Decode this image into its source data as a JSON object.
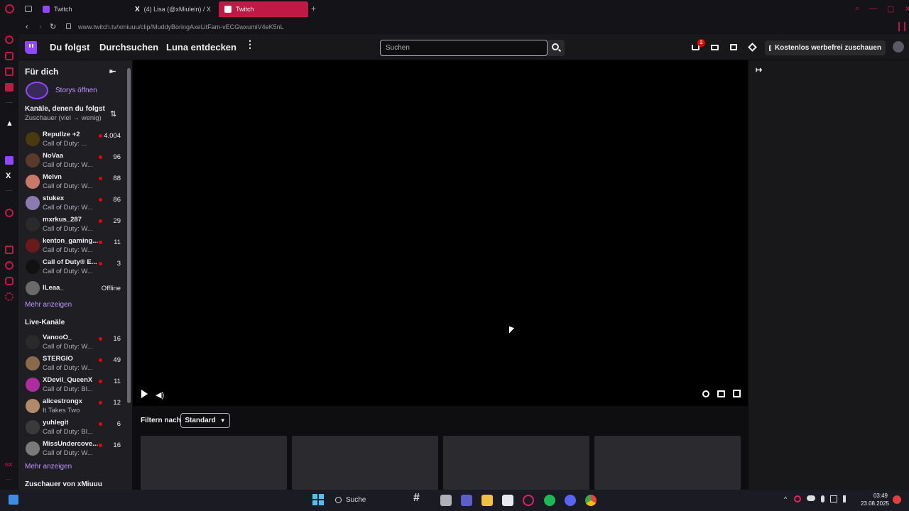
{
  "browser": {
    "tabs": [
      {
        "label": "Twitch",
        "active": false
      },
      {
        "label": "(4) Lisa (@xMiulein) / X",
        "active": false
      },
      {
        "label": "Twitch",
        "active": true
      }
    ],
    "url": "www.twitch.tv/xmiuuu/clip/MuddyBoringAxeLitFam-vECGwxumiV4eK5nL"
  },
  "nav": {
    "following": "Du folgst",
    "browse": "Durchsuchen",
    "luna": "Luna entdecken",
    "search_placeholder": "Suchen",
    "notif_count": "2",
    "adfree": "Kostenlos werbefrei zuschauen"
  },
  "sidebar": {
    "title": "Für dich",
    "stories": "Storys öffnen",
    "followed_title": "Kanäle, denen du folgst",
    "followed_sort": "Zuschauer (viel → wenig)",
    "followed": [
      {
        "name": "Repullze +2",
        "game": "Call of Duty: ...",
        "viewers": "4.004",
        "color": "#4a3a10"
      },
      {
        "name": "NoVaa",
        "game": "Call of Duty: W...",
        "viewers": "96",
        "color": "#5a3a2a"
      },
      {
        "name": "Melvn",
        "game": "Call of Duty: W...",
        "viewers": "88",
        "color": "#c87a6a"
      },
      {
        "name": "stukex",
        "game": "Call of Duty: W...",
        "viewers": "86",
        "color": "#8a7ab0"
      },
      {
        "name": "mxrkus_287",
        "game": "Call of Duty: W...",
        "viewers": "29",
        "color": "#2a2a2a"
      },
      {
        "name": "kenton_gaming...",
        "game": "Call of Duty: W...",
        "viewers": "11",
        "color": "#6a1a1a"
      },
      {
        "name": "Call of Duty® E...",
        "game": "Call of Duty: W...",
        "viewers": "3",
        "color": "#111111"
      },
      {
        "name": "lLeaa_",
        "game": "",
        "viewers": "Offline",
        "color": "#6a6a6a"
      }
    ],
    "more1": "Mehr anzeigen",
    "live_title": "Live-Kanäle",
    "live": [
      {
        "name": "VanooO_",
        "game": "Call of Duty: W...",
        "viewers": "16",
        "color": "#2a2a2a"
      },
      {
        "name": "STERGIO",
        "game": "Call of Duty: W...",
        "viewers": "49",
        "color": "#8a6a4a"
      },
      {
        "name": "XDevil_QueenX",
        "game": "Call of Duty: Bl...",
        "viewers": "11",
        "color": "#b02aa0"
      },
      {
        "name": "alicestrongx",
        "game": "It Takes Two",
        "viewers": "12",
        "color": "#b08a6a"
      },
      {
        "name": "yuhlegit",
        "game": "Call of Duty: Bl...",
        "viewers": "6",
        "color": "#3a3a3a"
      },
      {
        "name": "MissUndercove...",
        "game": "Call of Duty: W...",
        "viewers": "16",
        "color": "#7a7a7a"
      }
    ],
    "more2": "Mehr anzeigen",
    "viewers_of": "Zuschauer von xMiuuu"
  },
  "main": {
    "filter_label": "Filtern nach",
    "filter_value": "Standard"
  },
  "taskbar": {
    "search": "Suche",
    "time": "03:49",
    "date": "23.08.2025"
  }
}
